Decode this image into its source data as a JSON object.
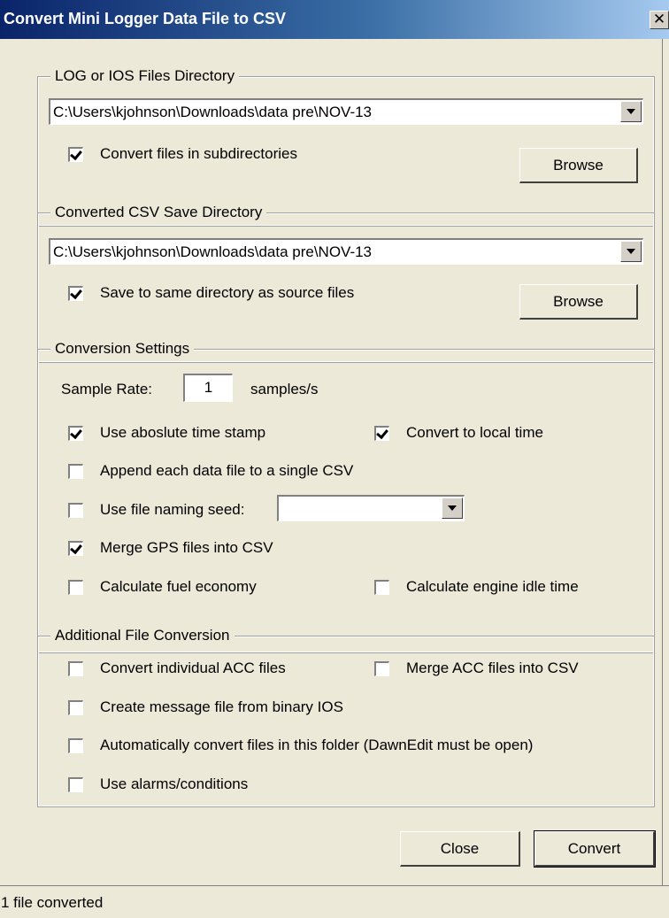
{
  "window": {
    "title": "Convert Mini Logger Data File to CSV",
    "close_glyph": "✕"
  },
  "log_dir": {
    "label": "LOG or IOS Files Directory",
    "path": "C:\\Users\\kjohnson\\Downloads\\data pre\\NOV-13",
    "subdir_label": "Convert files in subdirectories",
    "subdir_checked": true,
    "browse_label": "Browse"
  },
  "csv_dir": {
    "label": "Converted CSV Save Directory",
    "path": "C:\\Users\\kjohnson\\Downloads\\data pre\\NOV-13",
    "same_dir_label": "Save to same directory as source files",
    "same_dir_checked": true,
    "browse_label": "Browse"
  },
  "conversion": {
    "label": "Conversion Settings",
    "sample_rate_label": "Sample Rate:",
    "sample_rate_value": "1",
    "sample_rate_unit": "samples/s",
    "absolute_timestamp_label": "Use aboslute time stamp",
    "absolute_timestamp_checked": true,
    "local_time_label": "Convert to local time",
    "local_time_checked": true,
    "append_label": "Append each data file to a single CSV",
    "append_checked": false,
    "naming_seed_label": "Use file naming seed:",
    "naming_seed_checked": false,
    "naming_seed_value": "",
    "merge_gps_label": "Merge GPS files into CSV",
    "merge_gps_checked": true,
    "fuel_economy_label": "Calculate fuel economy",
    "fuel_economy_checked": false,
    "engine_idle_label": "Calculate engine idle time",
    "engine_idle_checked": false
  },
  "additional": {
    "label": "Additional File Conversion",
    "acc_individual_label": "Convert individual ACC files",
    "acc_individual_checked": false,
    "merge_acc_label": "Merge ACC files into CSV",
    "merge_acc_checked": false,
    "message_file_label": "Create message file from binary IOS",
    "message_file_checked": false,
    "auto_convert_label": "Automatically convert files in this folder (DawnEdit must be open)",
    "auto_convert_checked": false,
    "alarms_label": "Use alarms/conditions",
    "alarms_checked": false
  },
  "buttons": {
    "close_label": "Close",
    "convert_label": "Convert"
  },
  "status": {
    "text": "1 file converted"
  },
  "colors": {
    "title_bar": "#0a246a",
    "dialog_bg": "#ece9d8"
  }
}
